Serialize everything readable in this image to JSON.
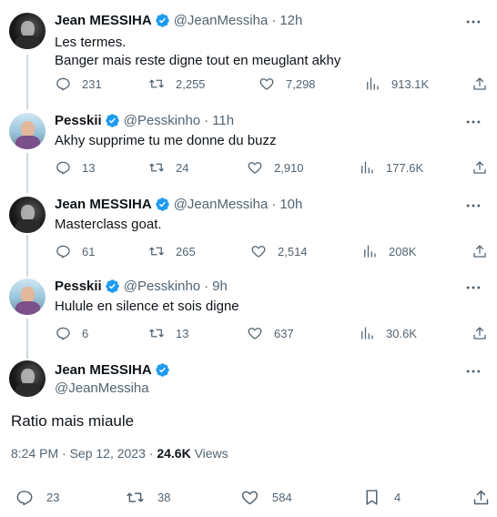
{
  "tweets": [
    {
      "name": "Jean MESSIHA",
      "handle": "@JeanMessiha",
      "time": "12h",
      "text_lines": [
        "Les termes.",
        "Banger mais reste digne tout en meuglant akhy"
      ],
      "replies": "231",
      "retweets": "2,255",
      "likes": "7,298",
      "views": "913.1K"
    },
    {
      "name": "Pesskii",
      "handle": "@Pesskinho",
      "time": "11h",
      "text_lines": [
        "Akhy supprime tu me donne du buzz"
      ],
      "replies": "13",
      "retweets": "24",
      "likes": "2,910",
      "views": "177.6K"
    },
    {
      "name": "Jean MESSIHA",
      "handle": "@JeanMessiha",
      "time": "10h",
      "text_lines": [
        "Masterclass goat."
      ],
      "replies": "61",
      "retweets": "265",
      "likes": "2,514",
      "views": "208K"
    },
    {
      "name": "Pesskii",
      "handle": "@Pesskinho",
      "time": "9h",
      "text_lines": [
        "Hulule en silence et sois digne"
      ],
      "replies": "6",
      "retweets": "13",
      "likes": "637",
      "views": "30.6K"
    }
  ],
  "focal": {
    "name": "Jean MESSIHA",
    "handle": "@JeanMessiha",
    "text": "Ratio mais miaule",
    "datetime": "8:24 PM · Sep 12, 2023 · ",
    "views_count": "24.6K",
    "views_label": " Views",
    "replies": "23",
    "retweets": "38",
    "likes": "584",
    "bookmarks": "4"
  },
  "colors": {
    "verified": "#1d9bf0",
    "secondary_text": "#536471",
    "thread_line": "#cfd9de"
  },
  "icons": [
    "reply-icon",
    "retweet-icon",
    "like-icon",
    "views-icon",
    "share-icon",
    "bookmark-icon",
    "verified-icon",
    "more-icon"
  ]
}
